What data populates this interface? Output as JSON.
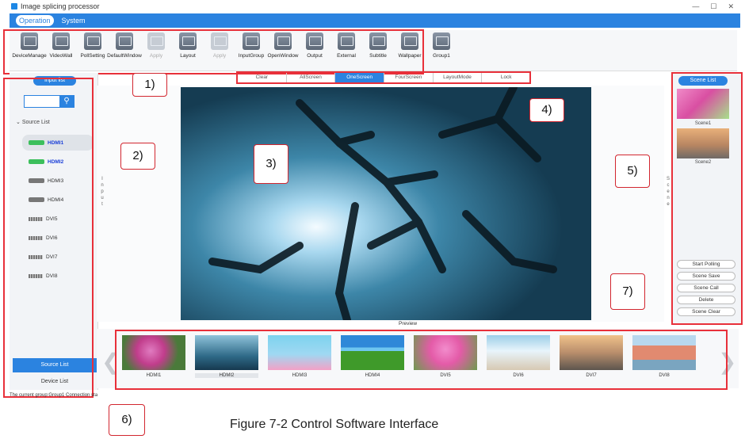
{
  "window": {
    "title": "Image splicing processor",
    "minimize": "—",
    "maximize": "☐",
    "close": "✕"
  },
  "menu": {
    "items": [
      {
        "label": "Operation",
        "active": true
      },
      {
        "label": "System",
        "active": false
      }
    ]
  },
  "toolbar": {
    "items": [
      {
        "label": "DeviceManage",
        "icon": "device-manage-icon",
        "disabled": false
      },
      {
        "label": "VideoWall",
        "icon": "video-wall-icon",
        "disabled": false
      },
      {
        "label": "PollSetting",
        "icon": "poll-setting-icon",
        "disabled": false
      },
      {
        "label": "DefaultWindow",
        "icon": "default-window-icon",
        "disabled": false
      },
      {
        "label": "Apply",
        "icon": "apply-icon",
        "disabled": true
      },
      {
        "label": "Layout",
        "icon": "layout-icon",
        "disabled": false
      },
      {
        "label": "Apply",
        "icon": "apply-icon",
        "disabled": true
      },
      {
        "label": "InputGroup",
        "icon": "input-group-icon",
        "disabled": false
      },
      {
        "label": "OpenWindow",
        "icon": "open-window-icon",
        "disabled": false
      },
      {
        "label": "Output",
        "icon": "output-icon",
        "disabled": false
      },
      {
        "label": "External",
        "icon": "external-icon",
        "disabled": false
      },
      {
        "label": "Subtitle",
        "icon": "subtitle-icon",
        "disabled": false
      },
      {
        "label": "Wallpaper",
        "icon": "wallpaper-icon",
        "disabled": false
      },
      {
        "label": "Group1",
        "icon": "group-icon",
        "disabled": false
      }
    ]
  },
  "tabs": [
    {
      "label": "Clear",
      "active": false
    },
    {
      "label": "AllScreen",
      "active": false
    },
    {
      "label": "OneScreen",
      "active": true
    },
    {
      "label": "FourScreen",
      "active": false
    },
    {
      "label": "LayoutMode",
      "active": false
    },
    {
      "label": "Lock",
      "active": false
    }
  ],
  "left_panel": {
    "input_list_label": "Input list",
    "source_list_header": "Source List",
    "sources": [
      {
        "label": "HDMI1",
        "type": "hdmi",
        "highlight": true,
        "selected": true
      },
      {
        "label": "HDMI2",
        "type": "hdmi",
        "highlight": true,
        "selected": false
      },
      {
        "label": "HDMI3",
        "type": "hdmi",
        "highlight": false,
        "selected": false
      },
      {
        "label": "HDMI4",
        "type": "hdmi",
        "highlight": false,
        "selected": false
      },
      {
        "label": "DVI5",
        "type": "dvi",
        "highlight": false,
        "selected": false
      },
      {
        "label": "DVI6",
        "type": "dvi",
        "highlight": false,
        "selected": false
      },
      {
        "label": "DVI7",
        "type": "dvi",
        "highlight": false,
        "selected": false
      },
      {
        "label": "DVI8",
        "type": "dvi",
        "highlight": false,
        "selected": false
      }
    ],
    "source_list_tab": "Source List",
    "device_list_tab": "Device List"
  },
  "status": {
    "text": "The current group:Group1   Connection sta"
  },
  "preview": {
    "input_vertical": "Input",
    "scene_vertical": "Scene",
    "label": "Preview"
  },
  "right_panel": {
    "scene_list_label": "Scene List",
    "scenes": [
      {
        "label": "Scene1"
      },
      {
        "label": "Scene2"
      }
    ],
    "buttons": [
      "Start Polling",
      "Scene Save",
      "Scene Call",
      "Delete",
      "Scene Clear"
    ]
  },
  "thumbnails": [
    "HDMI1",
    "HDMI2",
    "HDMI3",
    "HDMI4",
    "DVI5",
    "DVI6",
    "DVI7",
    "DVI8"
  ],
  "callouts": [
    "1)",
    "2)",
    "3)",
    "4)",
    "5)",
    "6)",
    "7)"
  ],
  "caption": "Figure 7-2 Control Software Interface",
  "colors": {
    "accent": "#2b83e0",
    "callout": "#e8303a"
  }
}
